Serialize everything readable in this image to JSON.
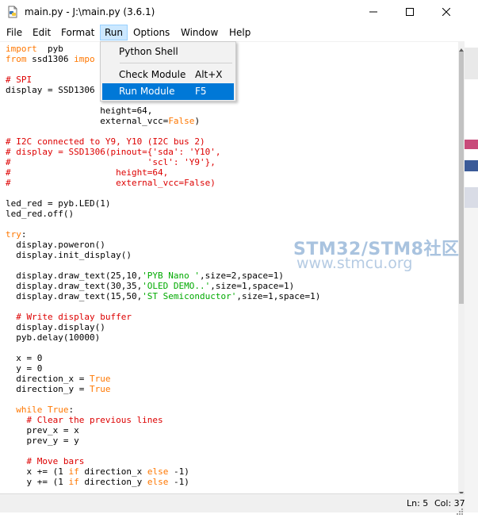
{
  "window": {
    "title": "main.py - J:\\main.py (3.6.1)"
  },
  "menubar": {
    "items": [
      {
        "id": "file",
        "label": "File"
      },
      {
        "id": "edit",
        "label": "Edit"
      },
      {
        "id": "format",
        "label": "Format"
      },
      {
        "id": "run",
        "label": "Run"
      },
      {
        "id": "options",
        "label": "Options"
      },
      {
        "id": "window",
        "label": "Window"
      },
      {
        "id": "help",
        "label": "Help"
      }
    ]
  },
  "run_menu": {
    "items": [
      {
        "label": "Python Shell",
        "accel": ""
      },
      {
        "label": "Check Module",
        "accel": "Alt+X"
      },
      {
        "label": "Run Module",
        "accel": "F5"
      }
    ]
  },
  "editor": {
    "lines": [
      [
        [
          "kw",
          "import"
        ],
        [
          "",
          "  pyb"
        ]
      ],
      [
        [
          "kw",
          "from"
        ],
        [
          "",
          " ssd1306 "
        ],
        [
          "kw",
          "impo"
        ]
      ],
      [],
      [
        [
          "cm",
          "# SPI"
        ]
      ],
      [
        [
          "",
          "display = SSD1306"
        ]
      ],
      [
        [
          "",
          "                          "
        ]
      ],
      [
        [
          "",
          "                  height=64,"
        ]
      ],
      [
        [
          "",
          "                  external_vcc="
        ],
        [
          "kw",
          "False"
        ],
        [
          "",
          ")"
        ]
      ],
      [],
      [
        [
          "cm",
          "# I2C connected to Y9, Y10 (I2C bus 2)"
        ]
      ],
      [
        [
          "cm",
          "# display = SSD1306(pinout={'sda': 'Y10',"
        ]
      ],
      [
        [
          "cm",
          "#                          'scl': 'Y9'},"
        ]
      ],
      [
        [
          "cm",
          "#                    height=64,"
        ]
      ],
      [
        [
          "cm",
          "#                    external_vcc=False)"
        ]
      ],
      [],
      [
        [
          "",
          "led_red = pyb.LED(1)"
        ]
      ],
      [
        [
          "",
          "led_red.off()"
        ]
      ],
      [],
      [
        [
          "kw",
          "try"
        ],
        [
          "",
          ":"
        ]
      ],
      [
        [
          "",
          "  display.poweron()"
        ]
      ],
      [
        [
          "",
          "  display.init_display()"
        ]
      ],
      [],
      [
        [
          "",
          "  display.draw_text(25,10,"
        ],
        [
          "st",
          "'PYB Nano '"
        ],
        [
          "",
          ",size=2,space=1)"
        ]
      ],
      [
        [
          "",
          "  display.draw_text(30,35,"
        ],
        [
          "st",
          "'OLED DEMO..'"
        ],
        [
          "",
          ",size=1,space=1)"
        ]
      ],
      [
        [
          "",
          "  display.draw_text(15,50,"
        ],
        [
          "st",
          "'ST Semiconductor'"
        ],
        [
          "",
          ",size=1,space=1)"
        ]
      ],
      [],
      [
        [
          "cm",
          "  # Write display buffer"
        ]
      ],
      [
        [
          "",
          "  display.display()"
        ]
      ],
      [
        [
          "",
          "  pyb.delay(10000)"
        ]
      ],
      [],
      [
        [
          "",
          "  x = 0"
        ]
      ],
      [
        [
          "",
          "  y = 0"
        ]
      ],
      [
        [
          "",
          "  direction_x = "
        ],
        [
          "kw",
          "True"
        ]
      ],
      [
        [
          "",
          "  direction_y = "
        ],
        [
          "kw",
          "True"
        ]
      ],
      [],
      [
        [
          "kw",
          "  while"
        ],
        [
          "",
          " "
        ],
        [
          "kw",
          "True"
        ],
        [
          "",
          ":"
        ]
      ],
      [
        [
          "cm",
          "    # Clear the previous lines"
        ]
      ],
      [
        [
          "",
          "    prev_x = x"
        ]
      ],
      [
        [
          "",
          "    prev_y = y"
        ]
      ],
      [],
      [
        [
          "cm",
          "    # Move bars"
        ]
      ],
      [
        [
          "",
          "    x += (1 "
        ],
        [
          "kw",
          "if"
        ],
        [
          "",
          " direction_x "
        ],
        [
          "kw",
          "else"
        ],
        [
          "",
          " -1)"
        ]
      ],
      [
        [
          "",
          "    y += (1 "
        ],
        [
          "kw",
          "if"
        ],
        [
          "",
          " direction_y "
        ],
        [
          "kw",
          "else"
        ],
        [
          "",
          " -1)"
        ]
      ]
    ]
  },
  "statusbar": {
    "line": "Ln: 5",
    "col": "Col: 37"
  },
  "watermark": {
    "line1": "STM32/STM8社区",
    "line2": "www.stmcu.org"
  },
  "colors": {
    "keyword": "#ff7700",
    "comment": "#dd0000",
    "string": "#00aa00",
    "menu_highlight": "#0078d7",
    "menu_active_bg": "#cce8ff"
  }
}
